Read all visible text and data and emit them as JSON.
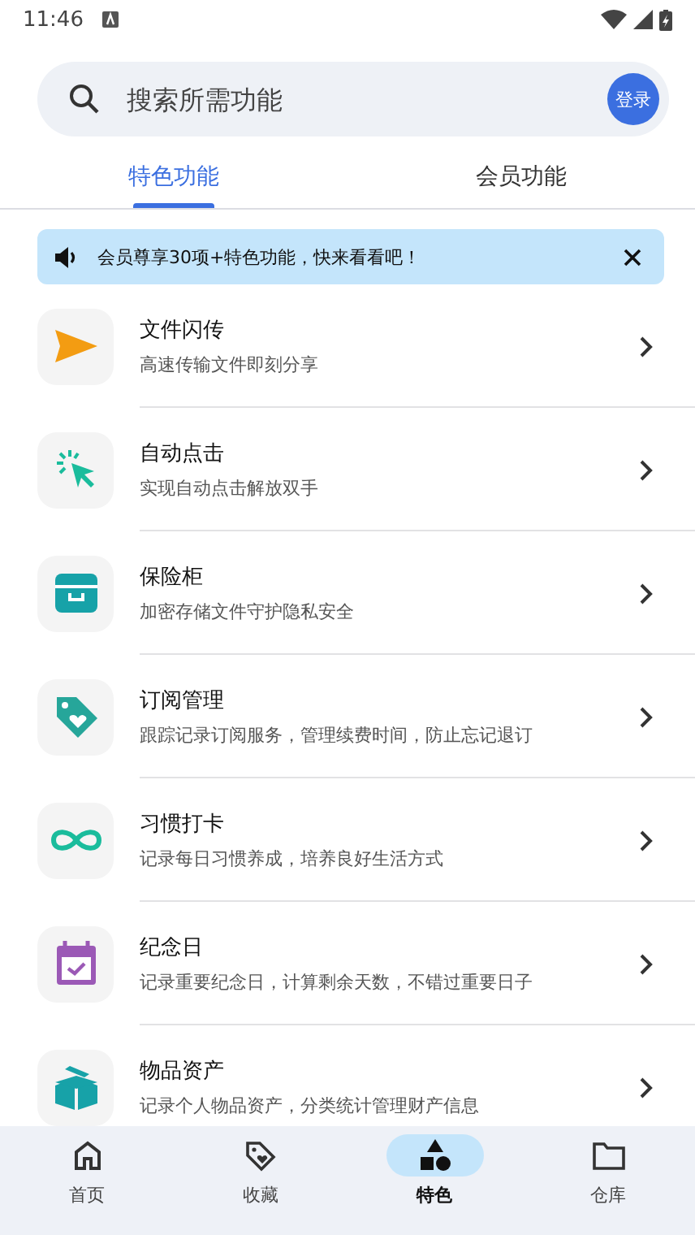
{
  "status_bar": {
    "time": "11:46"
  },
  "search": {
    "placeholder": "搜索所需功能",
    "login_button": "登录"
  },
  "tabs": [
    {
      "label": "特色功能",
      "selected": true
    },
    {
      "label": "会员功能",
      "selected": false
    }
  ],
  "banner": {
    "text": "会员尊享30项+特色功能，快来看看吧！"
  },
  "features": [
    {
      "title": "文件闪传",
      "subtitle": "高速传输文件即刻分享",
      "kind": "send",
      "color": "#f39c12"
    },
    {
      "title": "自动点击",
      "subtitle": "实现自动点击解放双手",
      "kind": "cursor",
      "color": "#1abc9c"
    },
    {
      "title": "保险柜",
      "subtitle": "加密存储文件守护隐私安全",
      "kind": "safe",
      "color": "#17a2a8"
    },
    {
      "title": "订阅管理",
      "subtitle": "跟踪记录订阅服务，管理续费时间，防止忘记退订",
      "kind": "tag",
      "color": "#26a69a"
    },
    {
      "title": "习惯打卡",
      "subtitle": "记录每日习惯养成，培养良好生活方式",
      "kind": "infinity",
      "color": "#1abc9c"
    },
    {
      "title": "纪念日",
      "subtitle": "记录重要纪念日，计算剩余天数，不错过重要日子",
      "kind": "calendar",
      "color": "#9b59b6"
    },
    {
      "title": "物品资产",
      "subtitle": "记录个人物品资产，分类统计管理财产信息",
      "kind": "box",
      "color": "#17a2a8"
    }
  ],
  "bottom_nav": [
    {
      "label": "首页",
      "kind": "home",
      "selected": false
    },
    {
      "label": "收藏",
      "kind": "tag",
      "selected": false
    },
    {
      "label": "特色",
      "kind": "shapes",
      "selected": true
    },
    {
      "label": "仓库",
      "kind": "folder",
      "selected": false
    }
  ]
}
